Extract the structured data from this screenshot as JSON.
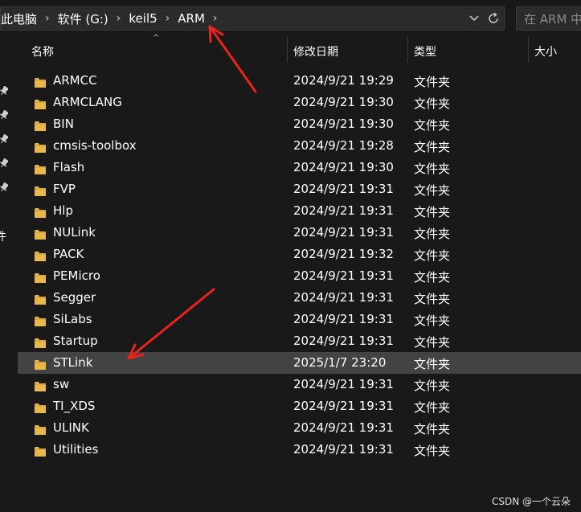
{
  "address_bar": {
    "crumbs": [
      "此电脑",
      "软件 (G:)",
      "keil5",
      "ARM"
    ]
  },
  "search": {
    "placeholder": "在 ARM 中"
  },
  "sidebar": {
    "partial_label": "件"
  },
  "columns": {
    "name": "名称",
    "date": "修改日期",
    "type": "类型",
    "size": "大小"
  },
  "files": [
    {
      "name": "ARMCC",
      "date": "2024/9/21 19:29",
      "type": "文件夹"
    },
    {
      "name": "ARMCLANG",
      "date": "2024/9/21 19:30",
      "type": "文件夹"
    },
    {
      "name": "BIN",
      "date": "2024/9/21 19:30",
      "type": "文件夹"
    },
    {
      "name": "cmsis-toolbox",
      "date": "2024/9/21 19:28",
      "type": "文件夹"
    },
    {
      "name": "Flash",
      "date": "2024/9/21 19:30",
      "type": "文件夹"
    },
    {
      "name": "FVP",
      "date": "2024/9/21 19:31",
      "type": "文件夹"
    },
    {
      "name": "Hlp",
      "date": "2024/9/21 19:31",
      "type": "文件夹"
    },
    {
      "name": "NULink",
      "date": "2024/9/21 19:31",
      "type": "文件夹"
    },
    {
      "name": "PACK",
      "date": "2024/9/21 19:32",
      "type": "文件夹"
    },
    {
      "name": "PEMicro",
      "date": "2024/9/21 19:31",
      "type": "文件夹"
    },
    {
      "name": "Segger",
      "date": "2024/9/21 19:31",
      "type": "文件夹"
    },
    {
      "name": "SiLabs",
      "date": "2024/9/21 19:31",
      "type": "文件夹"
    },
    {
      "name": "Startup",
      "date": "2024/9/21 19:31",
      "type": "文件夹"
    },
    {
      "name": "STLink",
      "date": "2025/1/7 23:20",
      "type": "文件夹",
      "selected": true
    },
    {
      "name": "sw",
      "date": "2024/9/21 19:31",
      "type": "文件夹"
    },
    {
      "name": "TI_XDS",
      "date": "2024/9/21 19:31",
      "type": "文件夹"
    },
    {
      "name": "ULINK",
      "date": "2024/9/21 19:31",
      "type": "文件夹"
    },
    {
      "name": "Utilities",
      "date": "2024/9/21 19:31",
      "type": "文件夹"
    }
  ],
  "watermark": "CSDN @一个云朵",
  "colors": {
    "background": "#191919",
    "selected_row": "#434343",
    "folder": "#e8b94a",
    "annotation_arrow": "#e8241c"
  },
  "icons": {
    "folder": "folder-icon",
    "chevron": "chevron-right-icon",
    "dropdown": "chevron-down-icon",
    "refresh": "refresh-icon",
    "pin": "pin-icon"
  }
}
